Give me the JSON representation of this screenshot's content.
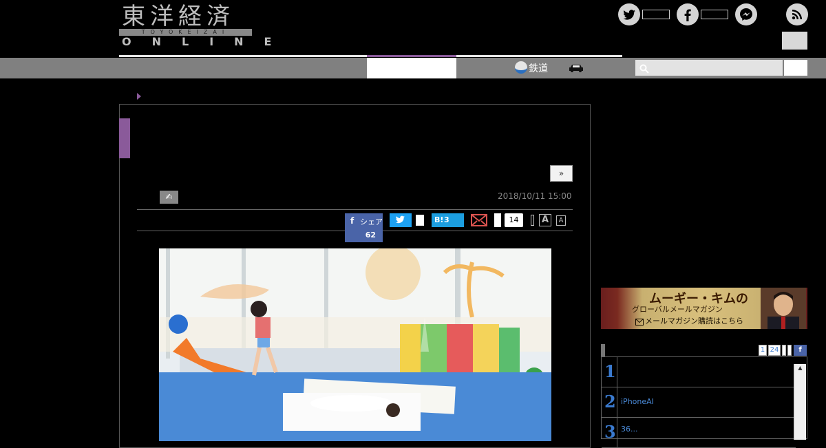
{
  "header": {
    "logo": {
      "jp": "東洋経済",
      "bar": "TOYOKEIZAI",
      "online": "ONLINE"
    },
    "social": [
      {
        "icon": "twitter-icon"
      },
      {
        "icon": "facebook-icon"
      },
      {
        "icon": "messenger-icon"
      },
      {
        "icon": "rss-icon"
      }
    ]
  },
  "nav": {
    "items": [
      {
        "label": "鉄道",
        "icon": "train-icon"
      },
      {
        "label": "",
        "icon": "car-icon"
      }
    ],
    "search": {
      "placeholder": ""
    }
  },
  "article": {
    "next_label": "»",
    "date": "2018/10/11 15:00",
    "share": {
      "facebook_label": "シェア",
      "facebook_count": "62",
      "hatena_label": "B!",
      "hatena_count": "3",
      "comment_count": "14"
    },
    "font_large": "A",
    "font_small": "A"
  },
  "sidebar": {
    "banner": {
      "line1": "ムーギー・キムの",
      "line2": "グローバルメールマガジン",
      "line3": "メールマガジン購読はこちら"
    },
    "ranking": {
      "tabs": [
        "1",
        "24"
      ],
      "items": [
        {
          "rank": "1",
          "title": ""
        },
        {
          "rank": "2",
          "title": "iPhoneAI"
        },
        {
          "rank": "3",
          "title": "36..."
        }
      ]
    }
  },
  "colors": {
    "accent": "#8a5a9a",
    "facebook": "#4a64a8",
    "twitter": "#1da1f2",
    "hatena": "#1c9ee0",
    "link": "#3a7acf"
  }
}
